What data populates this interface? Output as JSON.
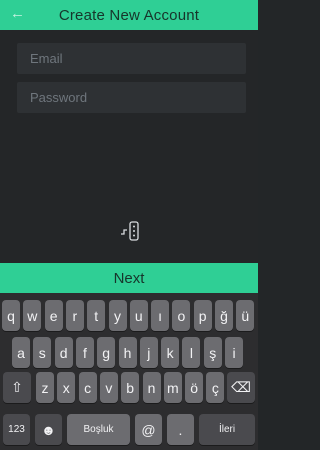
{
  "header": {
    "back_icon": "←",
    "title": "Create New Account"
  },
  "form": {
    "email_placeholder": "Email",
    "password_placeholder": "Password"
  },
  "next_button": {
    "label": "Next"
  },
  "keyboard": {
    "row1": [
      "q",
      "w",
      "e",
      "r",
      "t",
      "y",
      "u",
      "ı",
      "o",
      "p",
      "ğ",
      "ü"
    ],
    "row2": [
      "a",
      "s",
      "d",
      "f",
      "g",
      "h",
      "j",
      "k",
      "l",
      "ş",
      "i"
    ],
    "row3": [
      "z",
      "x",
      "c",
      "v",
      "b",
      "n",
      "m",
      "ö",
      "ç"
    ],
    "shift_icon": "⇧",
    "backspace_icon": "⌫",
    "numbers": "123",
    "emoji_icon": "☻",
    "space": "Boşluk",
    "at": "@",
    "dot": ".",
    "return": "İleri"
  },
  "colors": {
    "accent": "#2fcf95",
    "background": "#242628"
  }
}
